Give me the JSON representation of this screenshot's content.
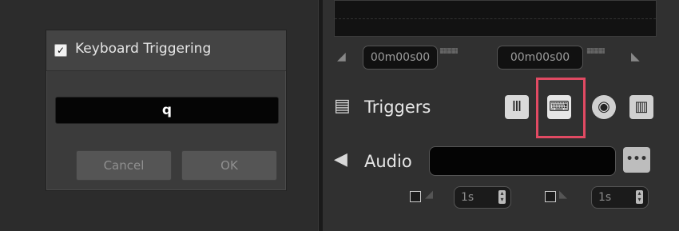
{
  "dialog": {
    "title": "Keyboard Triggering",
    "checked": true,
    "key_value": "q",
    "cancel_label": "Cancel",
    "ok_label": "OK"
  },
  "timecodes": {
    "in": "00m00s00",
    "out": "00m00s00"
  },
  "triggers": {
    "label": "Triggers",
    "buttons": [
      "midi-trigger-icon",
      "keyboard-trigger-icon",
      "dmx-trigger-icon",
      "timecode-trigger-icon"
    ],
    "highlighted": "keyboard-trigger-icon"
  },
  "audio": {
    "label": "Audio",
    "value": "",
    "more_label": "•••"
  },
  "fades": {
    "fade_in_value": "1s",
    "fade_out_value": "1s"
  },
  "colors": {
    "highlight": "#e14a63",
    "panel_bg": "#303030",
    "field_bg": "#050505"
  }
}
